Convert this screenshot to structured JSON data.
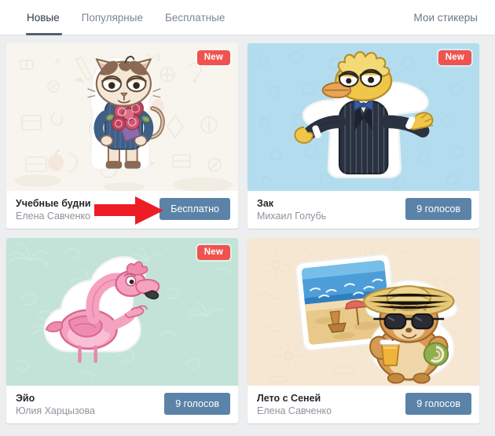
{
  "nav": {
    "tabs": [
      {
        "label": "Новые",
        "active": true
      },
      {
        "label": "Популярные",
        "active": false
      },
      {
        "label": "Бесплатные",
        "active": false
      }
    ],
    "my_stickers": "Мои стикеры"
  },
  "badges": {
    "new_label": "New"
  },
  "annotation": {
    "type": "red-arrow",
    "color": "#ee1c24",
    "points_to": "Бесплатно"
  },
  "colors": {
    "page_background": "#edeef0",
    "card_background": "#ffffff",
    "active_tab_underline": "#55606e",
    "button": "#5b83a8",
    "badge_new": "#ef5350",
    "arrow": "#ee1c24"
  },
  "cards": [
    {
      "title": "Учебные будни",
      "author": "Елена Савченко",
      "button_label": "Бесплатно",
      "has_new_badge": true,
      "preview_bg": "#f7f5ee"
    },
    {
      "title": "Зак",
      "author": "Михаил Голубь",
      "button_label": "9 голосов",
      "has_new_badge": true,
      "preview_bg": "#b3ddee"
    },
    {
      "title": "Эйо",
      "author": "Юлия Харцызова",
      "button_label": "9 голосов",
      "has_new_badge": true,
      "preview_bg": "#c3e3d8"
    },
    {
      "title": "Лето с Сеней",
      "author": "Елена Савченко",
      "button_label": "9 голосов",
      "has_new_badge": false,
      "preview_bg": "#f6e7d2"
    }
  ]
}
